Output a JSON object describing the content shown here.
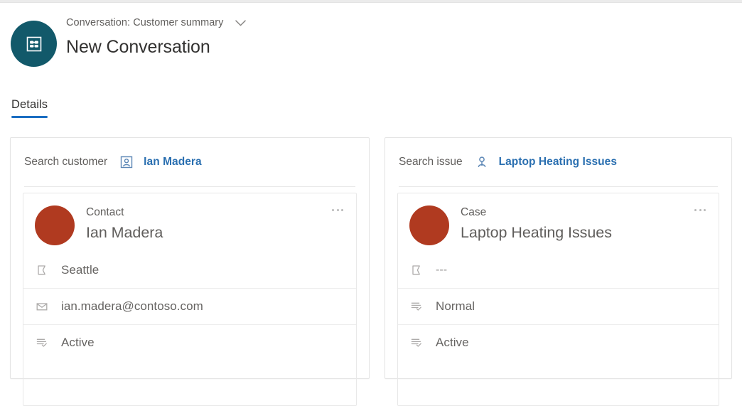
{
  "header": {
    "app_icon": "conversation-icon",
    "subtitle": "Conversation: Customer summary",
    "title": "New Conversation",
    "chevron_icon": "chevron-down-icon",
    "accent_color": "#12596a"
  },
  "tabs": [
    {
      "label": "Details",
      "active": true
    }
  ],
  "accent": {
    "tab_underline": "#1b6ec2",
    "link": "#2a6fb0",
    "avatar": "#b03a20"
  },
  "cards": [
    {
      "search": {
        "label": "Search customer",
        "entity_icon": "contact-card-icon",
        "value": "Ian Madera"
      },
      "entity": {
        "type": "Contact",
        "name": "Ian Madera",
        "more_icon": "more-options-icon",
        "attributes": [
          {
            "icon": "location-flag-icon",
            "value": "Seattle",
            "muted": false
          },
          {
            "icon": "envelope-icon",
            "value": "ian.madera@contoso.com",
            "muted": false
          },
          {
            "icon": "status-list-icon",
            "value": "Active",
            "muted": false
          }
        ]
      }
    },
    {
      "search": {
        "label": "Search issue",
        "entity_icon": "person-icon",
        "value": "Laptop Heating Issues"
      },
      "entity": {
        "type": "Case",
        "name": "Laptop Heating Issues",
        "more_icon": "more-options-icon",
        "attributes": [
          {
            "icon": "location-flag-icon",
            "value": "---",
            "muted": true
          },
          {
            "icon": "status-list-icon",
            "value": "Normal",
            "muted": false
          },
          {
            "icon": "status-list-icon",
            "value": "Active",
            "muted": false
          }
        ]
      }
    }
  ]
}
